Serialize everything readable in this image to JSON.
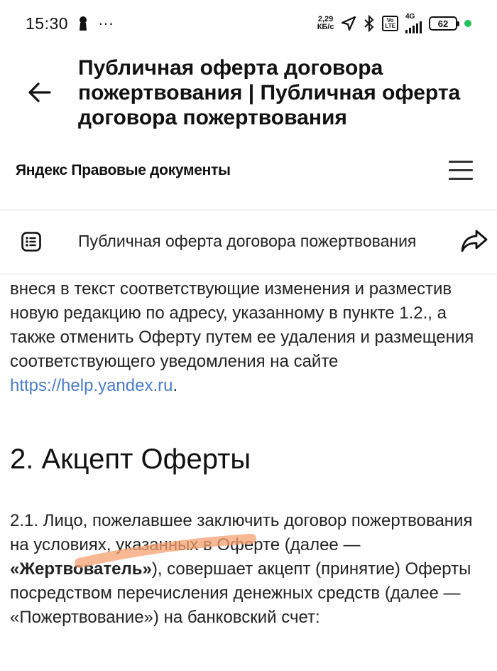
{
  "status_bar": {
    "time": "15:30",
    "dots": "···",
    "speed_value": "2,29",
    "speed_unit": "КБ/с",
    "volte_top": "Vo",
    "volte_bottom": "LTE",
    "network": "4G",
    "battery": "62"
  },
  "header": {
    "title": "Публичная оферта договора пожертвования | Публичная оферта договора пожертвования"
  },
  "site": {
    "logo": "Яндекс Правовые документы"
  },
  "doc_bar": {
    "title": "Публичная оферта договора пожертвования"
  },
  "content": {
    "para1_text": "внеся в текст соответствующие изменения и разместив новую редакцию по адресу, указанному в пункте 1.2., а также отменить Оферту путем ее удаления и размещения соответствующего уведомления на сайте ",
    "para1_link": "https://help.yandex.ru",
    "para1_end": ".",
    "section_heading": "2. Акцепт Оферты",
    "para2_start": "2.1. Лицо, пожелавшее заключить договор пожертвования на условиях, указанных в Оферте (далее — ",
    "para2_bold": "«Жертвователь»",
    "para2_end": "), совершает акцепт (принятие) Оферты посредством перечисления денежных средств (далее — «Пожертвование») на банковский счет:"
  },
  "colors": {
    "link": "#4a7dc6",
    "highlight": "#f5a070",
    "battery_dot": "#20c05c"
  }
}
